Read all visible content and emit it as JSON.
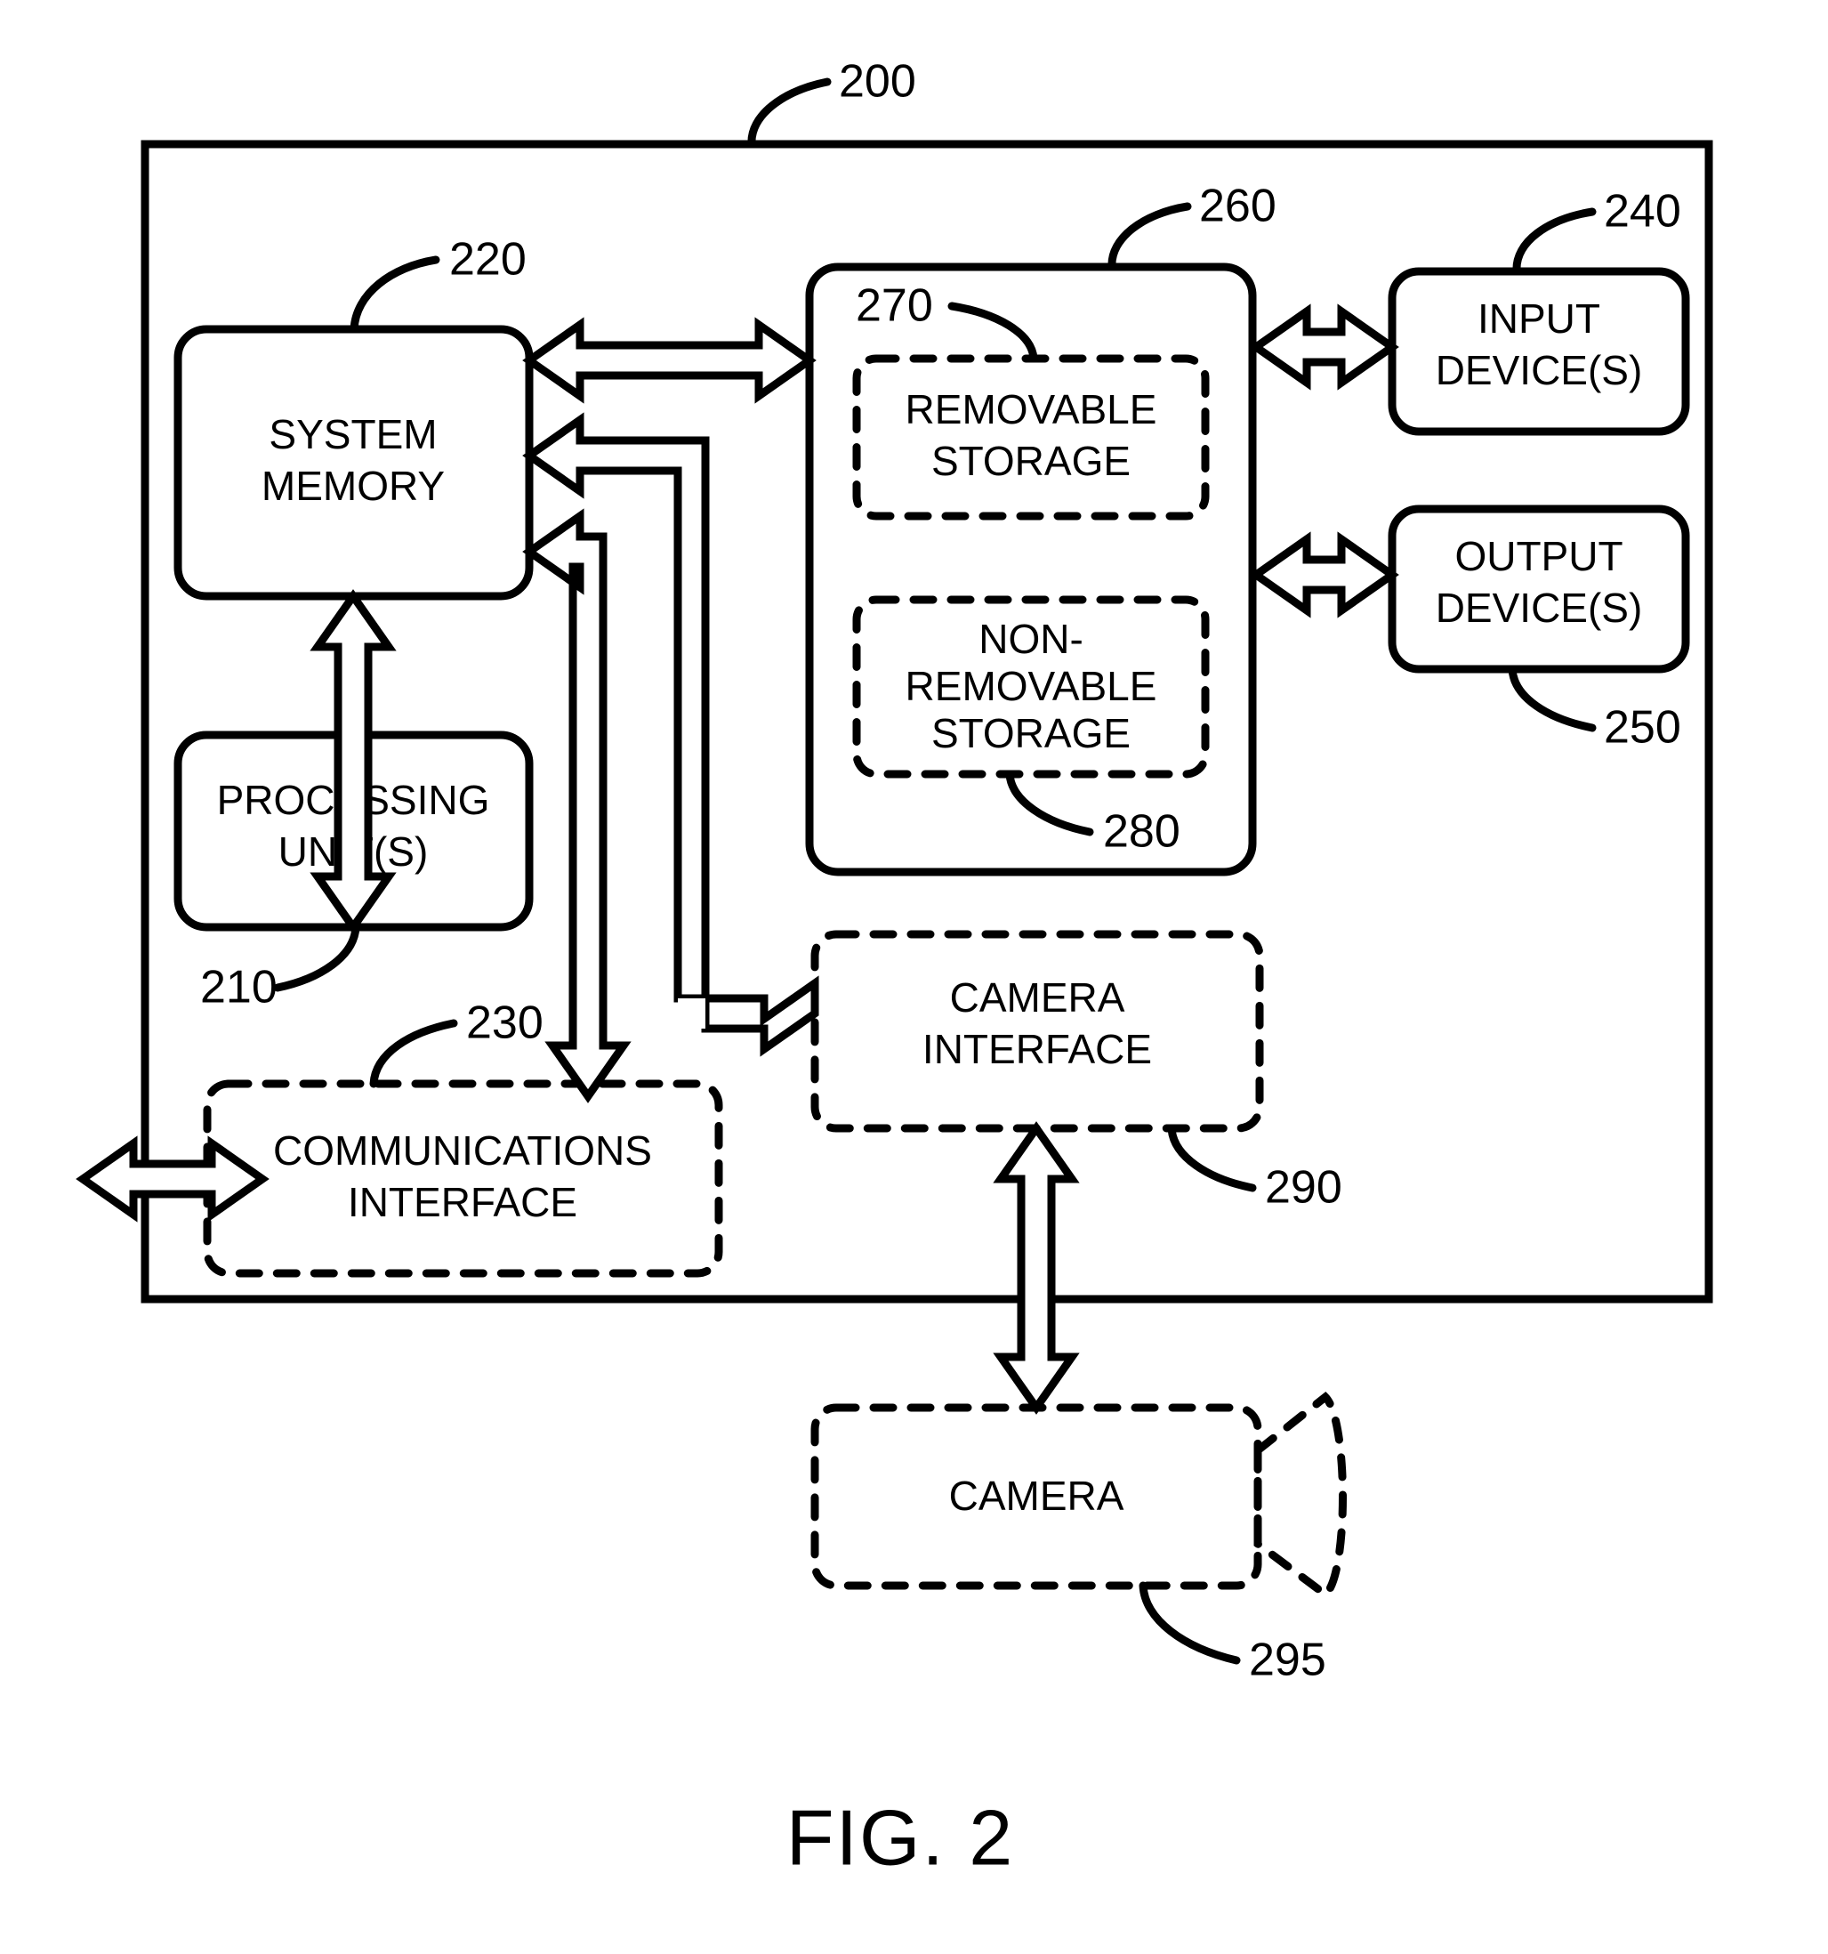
{
  "figure": {
    "caption": "FIG. 2",
    "system_ref": "200"
  },
  "boxes": {
    "system_memory": {
      "label_lines": [
        "SYSTEM",
        "MEMORY"
      ],
      "ref": "220",
      "style": "solid"
    },
    "processing_unit": {
      "label_lines": [
        "PROCESSING",
        "UNIT(S)"
      ],
      "ref": "210",
      "style": "solid"
    },
    "communications_interface": {
      "label_lines": [
        "COMMUNICATIONS",
        "INTERFACE"
      ],
      "ref": "230",
      "style": "dashed"
    },
    "storage_container": {
      "label_lines": [],
      "ref": "260",
      "style": "solid"
    },
    "removable_storage": {
      "label_lines": [
        "REMOVABLE",
        "STORAGE"
      ],
      "ref": "270",
      "style": "dashed"
    },
    "non_removable_storage": {
      "label_lines": [
        "NON-",
        "REMOVABLE",
        "STORAGE"
      ],
      "ref": "280",
      "style": "dashed"
    },
    "input_devices": {
      "label_lines": [
        "INPUT",
        "DEVICE(S)"
      ],
      "ref": "240",
      "style": "solid"
    },
    "output_devices": {
      "label_lines": [
        "OUTPUT",
        "DEVICE(S)"
      ],
      "ref": "250",
      "style": "solid"
    },
    "camera_interface": {
      "label_lines": [
        "CAMERA",
        "INTERFACE"
      ],
      "ref": "290",
      "style": "dashed"
    },
    "camera": {
      "label_lines": [
        "CAMERA"
      ],
      "ref": "295",
      "style": "dashed"
    }
  },
  "text": {
    "system_memory_line1": "SYSTEM",
    "system_memory_line2": "MEMORY",
    "processing_unit_line1": "PROCESSING",
    "processing_unit_line2": "UNIT(S)",
    "communications_line1": "COMMUNICATIONS",
    "communications_line2": "INTERFACE",
    "removable_line1": "REMOVABLE",
    "removable_line2": "STORAGE",
    "non_removable_line1": "NON-",
    "non_removable_line2": "REMOVABLE",
    "non_removable_line3": "STORAGE",
    "input_line1": "INPUT",
    "input_line2": "DEVICE(S)",
    "output_line1": "OUTPUT",
    "output_line2": "DEVICE(S)",
    "camera_interface_line1": "CAMERA",
    "camera_interface_line2": "INTERFACE",
    "camera_line1": "CAMERA",
    "caption": "FIG. 2"
  },
  "refs": {
    "r200": "200",
    "r210": "210",
    "r220": "220",
    "r230": "230",
    "r240": "240",
    "r250": "250",
    "r260": "260",
    "r270": "270",
    "r280": "280",
    "r290": "290",
    "r295": "295"
  },
  "colors": {
    "stroke": "#000000",
    "background": "#ffffff"
  }
}
